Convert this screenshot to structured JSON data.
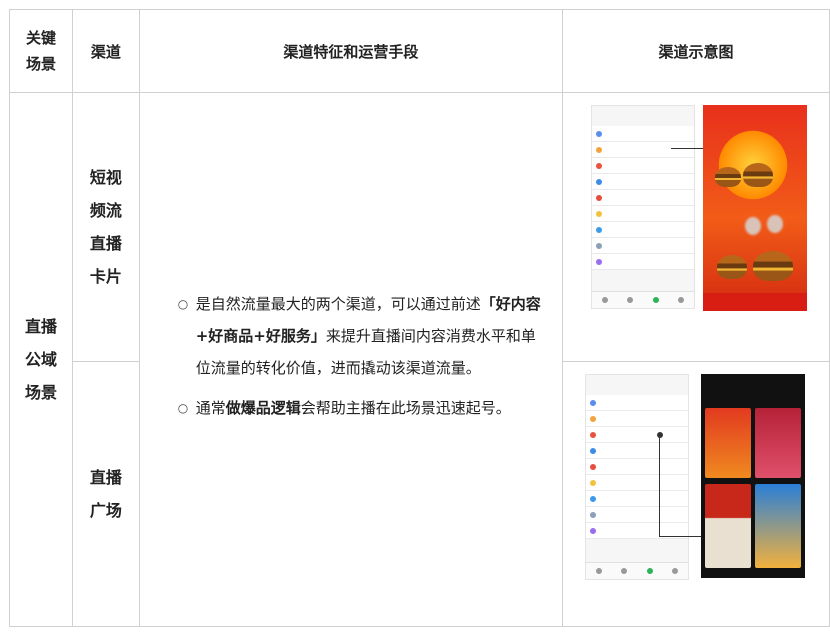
{
  "header": {
    "col_key": "关键场景",
    "col_channel": "渠道",
    "col_feature": "渠道特征和运营手段",
    "col_sample": "渠道示意图"
  },
  "rows": [
    {
      "scene": "直播公域场景",
      "channel_1": "短视频流直播卡片",
      "channel_2": "直播广场",
      "feature_1_pre": "是自然流量最大的两个渠道，可以通过前述",
      "feature_1_bold": "「好内容+好商品+好服务」",
      "feature_1_post": "来提升直播间内容消费水平和单位流量的转化价值，进而撬动该渠道流量。",
      "feature_2_pre": "通常",
      "feature_2_bold": "做爆品逻辑",
      "feature_2_post": "会帮助主播在此场景迅速起号。"
    }
  ],
  "icons": {
    "bullet": "hollow-circle-bullet"
  }
}
